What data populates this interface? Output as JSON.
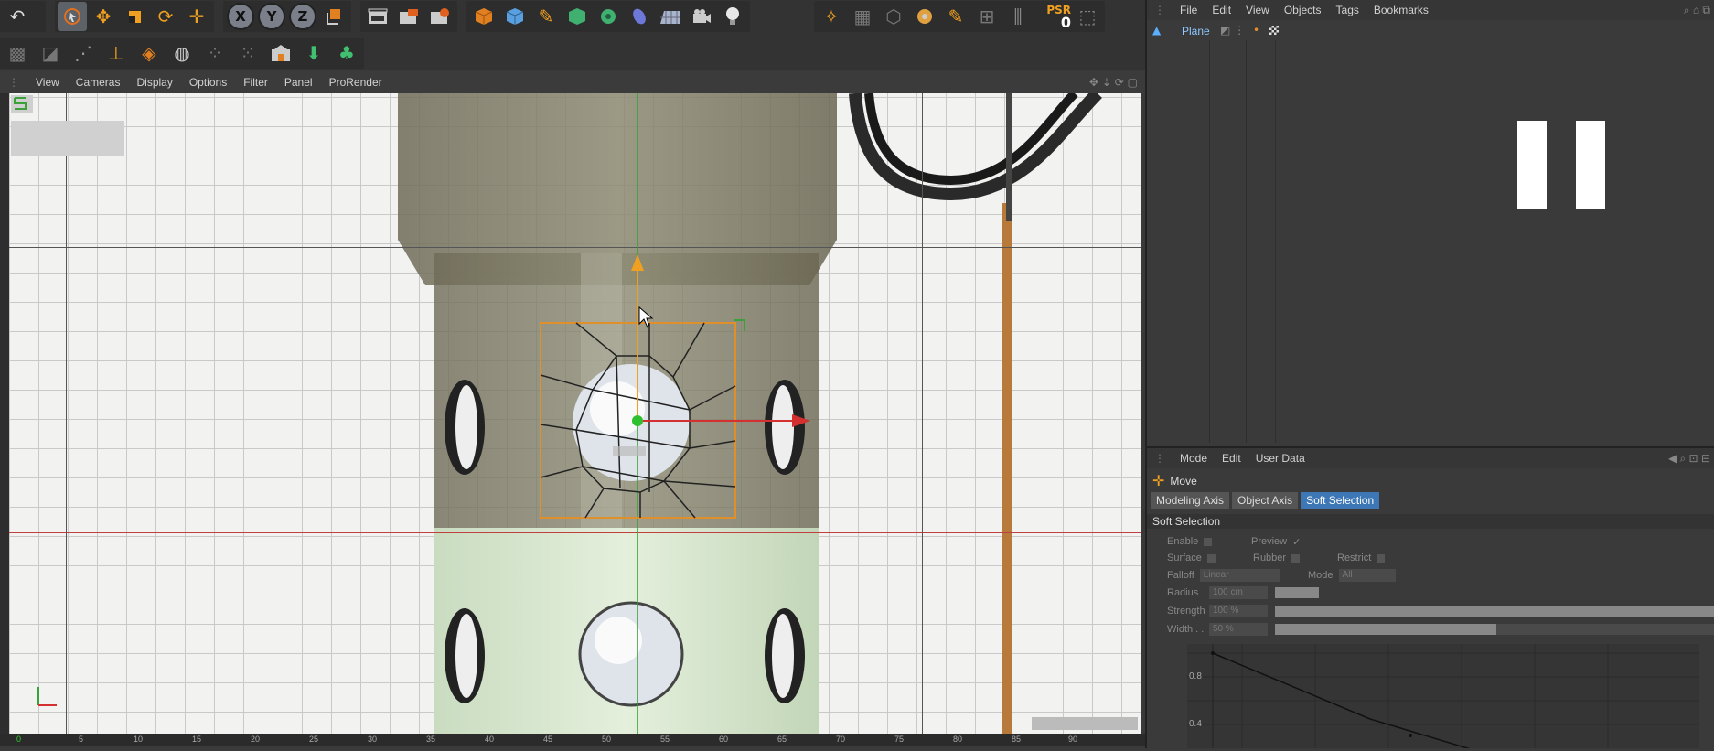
{
  "objects_menu": [
    "File",
    "Edit",
    "View",
    "Objects",
    "Tags",
    "Bookmarks"
  ],
  "object_list": [
    {
      "name": "Plane"
    }
  ],
  "viewport_menu": [
    "View",
    "Cameras",
    "Display",
    "Options",
    "Filter",
    "Panel",
    "ProRender"
  ],
  "psr": {
    "label": "PSR",
    "value": "0"
  },
  "axis_buttons": [
    "X",
    "Y",
    "Z"
  ],
  "attributes": {
    "menu": [
      "Mode",
      "Edit",
      "User Data"
    ],
    "tool_name": "Move",
    "tabs": [
      "Modeling Axis",
      "Object Axis",
      "Soft Selection"
    ],
    "active_tab": "Soft Selection",
    "section_title": "Soft Selection",
    "fields": {
      "enable": "Enable",
      "preview": "Preview",
      "preview_mark": "✓",
      "surface": "Surface",
      "rubber": "Rubber",
      "restrict": "Restrict",
      "falloff_label": "Falloff",
      "falloff_value": "Linear",
      "mode_label": "Mode",
      "mode_value": "All",
      "radius_label": "Radius",
      "radius_value": "100 cm",
      "strength_label": "Strength",
      "strength_value": "100 %",
      "width_label": "Width . .",
      "width_value": "50 %"
    },
    "graph_ticks": [
      "0.8",
      "0.4"
    ]
  },
  "timeline_ticks": [
    "0",
    "5",
    "10",
    "15",
    "20",
    "25",
    "30",
    "35",
    "40",
    "45",
    "50",
    "55",
    "60",
    "65",
    "70",
    "75",
    "80",
    "85",
    "90"
  ],
  "colors": {
    "accent": "#3d77b6",
    "axis_x": "#d43030",
    "axis_y": "#f0a020",
    "selection": "#e0902a",
    "pivot": "#2ec02e",
    "psr": "#f0a020"
  }
}
